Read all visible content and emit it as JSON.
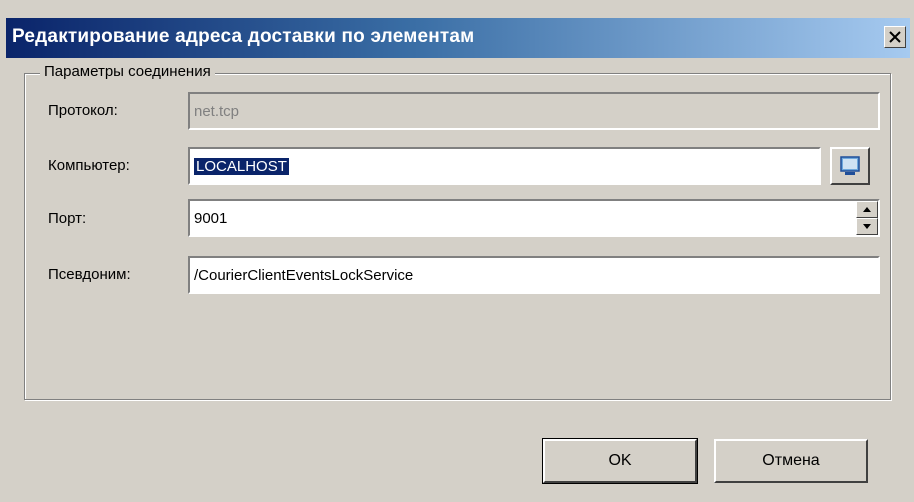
{
  "window": {
    "title": "Редактирование адреса доставки по элементам",
    "close_glyph": "✕"
  },
  "group": {
    "label": "Параметры соединения"
  },
  "fields": {
    "protocol": {
      "label": "Протокол:",
      "value": "net.tcp",
      "disabled": true
    },
    "computer": {
      "label": "Компьютер:",
      "value": "LOCALHOST",
      "selected": true,
      "browse_icon": "computer-icon"
    },
    "port": {
      "label": "Порт:",
      "value": "9001",
      "spinner_icons": [
        "spin-up-icon",
        "spin-down-icon"
      ]
    },
    "alias": {
      "label": "Псевдоним:",
      "value": "/CourierClientEventsLockService"
    }
  },
  "buttons": {
    "ok_label": "OK",
    "cancel_label": "Отмена"
  },
  "colors": {
    "title_start": "#0a246a",
    "title_end": "#a6caf0",
    "face": "#d4d0c8",
    "selection": "#0a246a"
  }
}
